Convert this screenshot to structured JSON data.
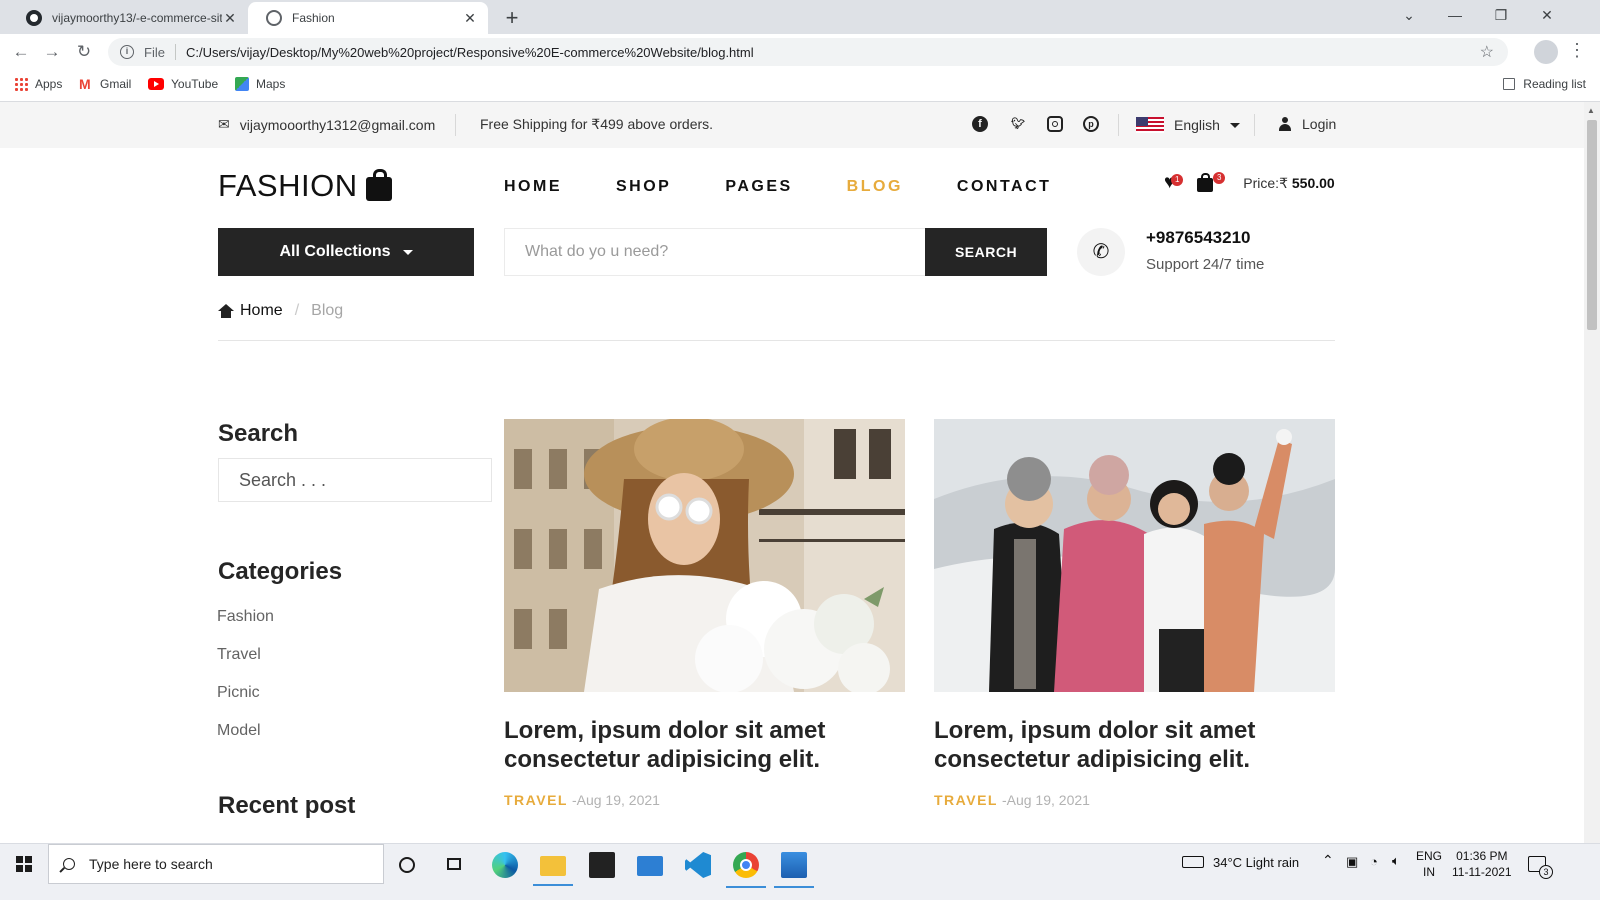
{
  "browser": {
    "tabs": [
      {
        "title": "vijaymoorthy13/-e-commerce-sit",
        "icon": "github-icon"
      },
      {
        "title": "Fashion",
        "icon": "globe-icon"
      }
    ],
    "address": {
      "scheme_label": "File",
      "url": "C:/Users/vijay/Desktop/My%20web%20project/Responsive%20E-commerce%20Website/blog.html"
    },
    "bookmarks": [
      "Apps",
      "Gmail",
      "YouTube",
      "Maps"
    ],
    "reading_list": "Reading list"
  },
  "topbar": {
    "email": "vijaymooorthy1312@gmail.com",
    "shipping": "Free Shipping for ₹499 above orders.",
    "language": "English",
    "login": "Login"
  },
  "header": {
    "logo": "FASHION",
    "nav": [
      {
        "label": "HOME",
        "active": false
      },
      {
        "label": "SHOP",
        "active": false
      },
      {
        "label": "PAGES",
        "active": false
      },
      {
        "label": "BLOG",
        "active": true
      },
      {
        "label": "CONTACT",
        "active": false
      }
    ],
    "wishlist_count": "1",
    "cart_count": "3",
    "price_label": "Price:₹",
    "price_value": "550.00",
    "collections_label": "All Collections",
    "search_placeholder": "What do yo u need?",
    "search_button": "SEARCH",
    "phone": "+9876543210",
    "support": "Support 24/7 time"
  },
  "breadcrumb": {
    "home": "Home",
    "separator": "/",
    "current": "Blog"
  },
  "sidebar": {
    "search_heading": "Search",
    "search_placeholder": "Search . . .",
    "categories_heading": "Categories",
    "categories": [
      "Fashion",
      "Travel",
      "Picnic",
      "Model"
    ],
    "recent_heading": "Recent post"
  },
  "posts": [
    {
      "title": "Lorem, ipsum dolor sit amet consectetur adipisicing elit.",
      "tag": "TRAVEL",
      "date": "-Aug 19, 2021"
    },
    {
      "title": "Lorem, ipsum dolor sit amet consectetur adipisicing elit.",
      "tag": "TRAVEL",
      "date": "-Aug 19, 2021"
    }
  ],
  "taskbar": {
    "search_placeholder": "Type here to search",
    "weather": "34°C  Light rain",
    "lang_top": "ENG",
    "lang_bottom": "IN",
    "time": "01:36 PM",
    "date": "11-11-2021",
    "notifications": "3"
  },
  "colors": {
    "accent": "#e7ab3c",
    "dark": "#252525",
    "badge": "#d63031"
  }
}
